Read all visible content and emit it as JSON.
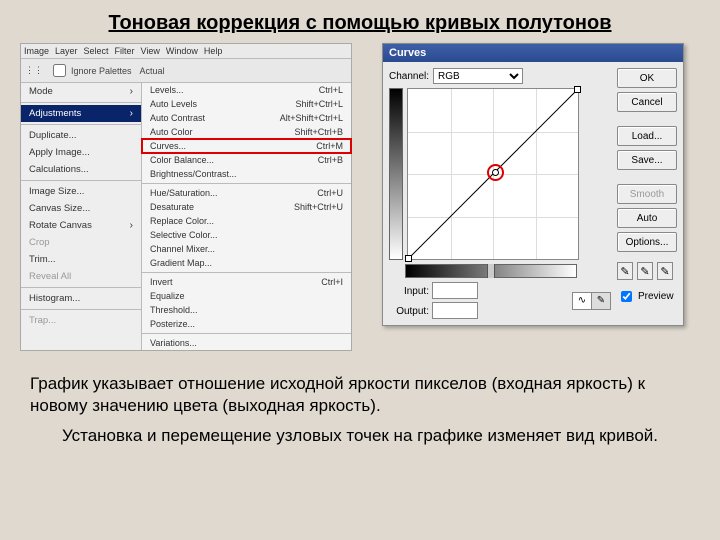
{
  "title": "Тоновая коррекция с помощью кривых полутонов",
  "menubar": [
    "Image",
    "Layer",
    "Select",
    "Filter",
    "View",
    "Window",
    "Help"
  ],
  "row2": {
    "ignore": "Ignore Palettes",
    "actual": "Actual"
  },
  "left_menu": {
    "items": [
      {
        "label": "Mode",
        "arrow": true
      },
      {
        "sep": true
      },
      {
        "label": "Adjustments",
        "arrow": true,
        "highlight": true
      },
      {
        "sep": true
      },
      {
        "label": "Duplicate..."
      },
      {
        "label": "Apply Image..."
      },
      {
        "label": "Calculations..."
      },
      {
        "sep": true
      },
      {
        "label": "Image Size..."
      },
      {
        "label": "Canvas Size..."
      },
      {
        "label": "Rotate Canvas",
        "arrow": true
      },
      {
        "label": "Crop",
        "dim": true
      },
      {
        "label": "Trim..."
      },
      {
        "label": "Reveal All",
        "dim": true
      },
      {
        "sep": true
      },
      {
        "label": "Histogram..."
      },
      {
        "sep": true
      },
      {
        "label": "Trap...",
        "dim": true
      }
    ]
  },
  "sub_menu": {
    "items": [
      {
        "label": "Levels...",
        "sc": "Ctrl+L"
      },
      {
        "label": "Auto Levels",
        "sc": "Shift+Ctrl+L"
      },
      {
        "label": "Auto Contrast",
        "sc": "Alt+Shift+Ctrl+L"
      },
      {
        "label": "Auto Color",
        "sc": "Shift+Ctrl+B"
      },
      {
        "label": "Curves...",
        "sc": "Ctrl+M",
        "boxed": true
      },
      {
        "label": "Color Balance...",
        "sc": "Ctrl+B"
      },
      {
        "label": "Brightness/Contrast..."
      },
      {
        "sep": true
      },
      {
        "label": "Hue/Saturation...",
        "sc": "Ctrl+U"
      },
      {
        "label": "Desaturate",
        "sc": "Shift+Ctrl+U"
      },
      {
        "label": "Replace Color..."
      },
      {
        "label": "Selective Color..."
      },
      {
        "label": "Channel Mixer..."
      },
      {
        "label": "Gradient Map..."
      },
      {
        "sep": true
      },
      {
        "label": "Invert",
        "sc": "Ctrl+I"
      },
      {
        "label": "Equalize"
      },
      {
        "label": "Threshold..."
      },
      {
        "label": "Posterize..."
      },
      {
        "sep": true
      },
      {
        "label": "Variations..."
      }
    ]
  },
  "curves": {
    "title": "Curves",
    "channel_label": "Channel:",
    "channel_value": "RGB",
    "input_label": "Input:",
    "output_label": "Output:",
    "buttons": {
      "ok": "OK",
      "cancel": "Cancel",
      "load": "Load...",
      "save": "Save...",
      "smooth": "Smooth",
      "auto": "Auto",
      "options": "Options..."
    },
    "preview": "Preview"
  },
  "chart_data": {
    "type": "line",
    "x": [
      0,
      128,
      255
    ],
    "y": [
      0,
      128,
      255
    ],
    "xlabel": "Input",
    "ylabel": "Output",
    "xlim": [
      0,
      255
    ],
    "ylim": [
      0,
      255
    ],
    "marked_point": {
      "x": 132,
      "y": 132
    }
  },
  "body_text": {
    "p1": "График указывает отношение исходной яркости пикселов (входная яркость) к новому значению цвета (выходная яркость).",
    "p2": "Установка и перемещение узловых точек на графике изменяет вид кривой."
  }
}
